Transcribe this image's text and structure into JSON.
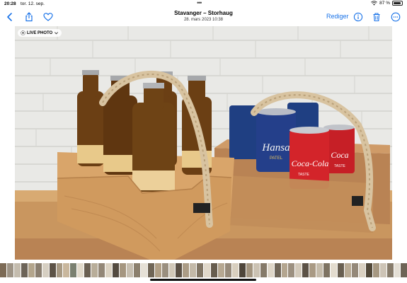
{
  "status_bar": {
    "time": "20:28",
    "date": "tor. 12. sep.",
    "battery_percent": "87 %"
  },
  "nav": {
    "title": "Stavanger – Storhaug",
    "subtitle": "28. mars 2023 10:38",
    "edit_label": "Rediger"
  },
  "photo": {
    "live_label": "LIVE PHOTO",
    "can_brand_blue": "Hansa",
    "can_brand_blue_sub": "PATEL",
    "can_brand_red": "Coca-Cola",
    "can_brand_red_sub": "TASTE",
    "can_brand_red_back": "Coca",
    "can_brand_red_back_sub": "TASTE"
  },
  "colors": {
    "accent": "#1a73e8",
    "wall": "#e9e9e6",
    "wood_light": "#d9a56a",
    "wood_dark": "#b98354",
    "can_blue": "#1f3f82",
    "can_red": "#d3242a"
  },
  "icons": {
    "back": "chevron-left-icon",
    "share": "share-icon",
    "favorite": "heart-icon",
    "info": "info-icon",
    "trash": "trash-icon",
    "more": "ellipsis-icon",
    "live": "live-photo-icon",
    "chevron": "chevron-down-icon"
  },
  "thumbnails": [
    "#7c6a55",
    "#9e9486",
    "#c4bcae",
    "#6d6458",
    "#b3a58c",
    "#8a7f70",
    "#d6cfc2",
    "#5d5347",
    "#a89a84",
    "#c9b79d",
    "#7a8070",
    "#e1dacb",
    "#6a6052",
    "#b8ad99",
    "#938777",
    "#dcd3c3",
    "#544b40",
    "#a59680",
    "#c7bfb1",
    "#8c806e",
    "#e6e1d7",
    "#6f6556",
    "#b09f86",
    "#9a8f7f",
    "#d1c8b8",
    "#5a5044",
    "#ab9c86",
    "#c3b9a8",
    "#807564",
    "#e0d8ca",
    "#675d4f",
    "#b6a892",
    "#978b7b",
    "#d8cfbf",
    "#4f463b",
    "#a39580",
    "#cbc2b3",
    "#857a69",
    "#ded6c8",
    "#706658",
    "#b4a690",
    "#9c9080",
    "#d3cabb",
    "#5c5246",
    "#a99a84",
    "#c5bcab",
    "#7e7362",
    "#e3dccf",
    "#695f51",
    "#baac96",
    "#958979",
    "#dad1c2",
    "#514839",
    "#a69882",
    "#cdc4b6",
    "#877c6b",
    "#e4dfd5",
    "#6e6456"
  ]
}
